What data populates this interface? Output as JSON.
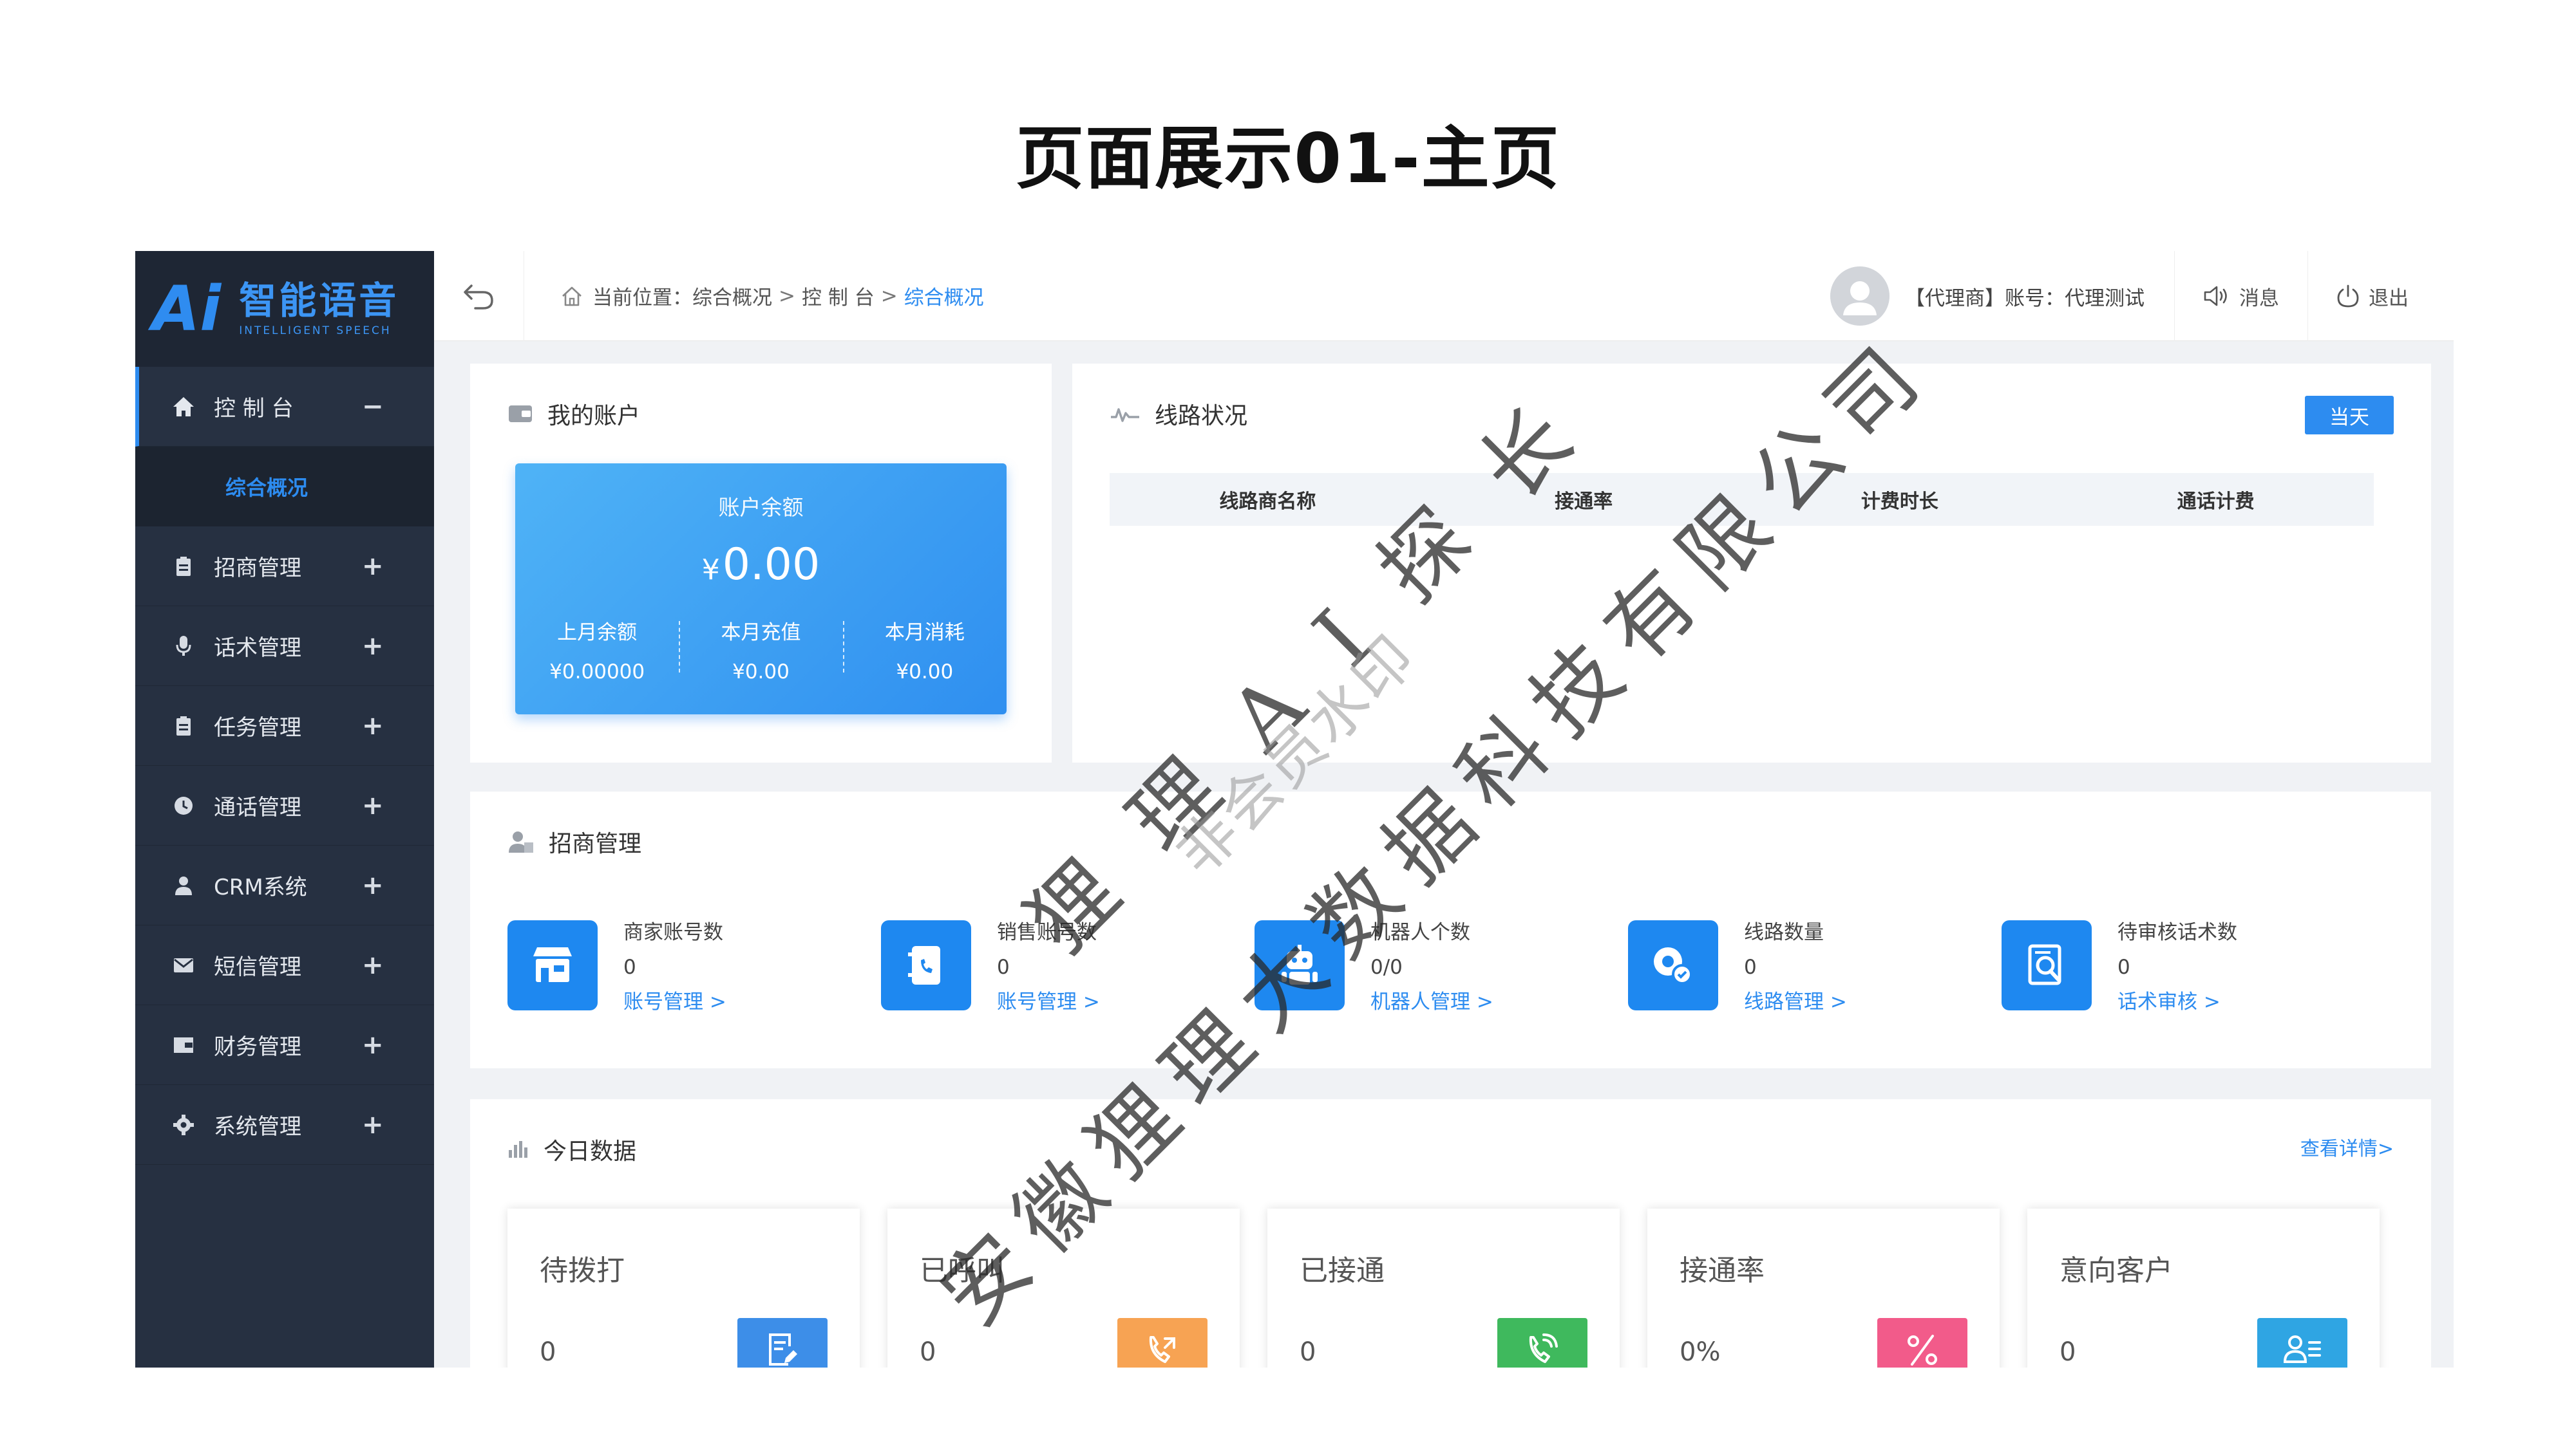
{
  "slide": {
    "title": "页面展示01-主页"
  },
  "logo": {
    "mark": "Ai",
    "name": "智能语音",
    "tagline": "INTELLIGENT SPEECH"
  },
  "sidebar": {
    "items": [
      {
        "label": "控 制 台",
        "toggle": "−",
        "icon": "home-icon",
        "active": true
      },
      {
        "label": "招商管理",
        "toggle": "+",
        "icon": "clipboard-icon"
      },
      {
        "label": "话术管理",
        "toggle": "+",
        "icon": "microphone-icon"
      },
      {
        "label": "任务管理",
        "toggle": "+",
        "icon": "clipboard-icon"
      },
      {
        "label": "通话管理",
        "toggle": "+",
        "icon": "clock-icon"
      },
      {
        "label": "CRM系统",
        "toggle": "+",
        "icon": "user-icon"
      },
      {
        "label": "短信管理",
        "toggle": "+",
        "icon": "envelope-icon"
      },
      {
        "label": "财务管理",
        "toggle": "+",
        "icon": "wallet-icon"
      },
      {
        "label": "系统管理",
        "toggle": "+",
        "icon": "gear-icon"
      }
    ],
    "sub_item": "综合概况"
  },
  "header": {
    "crumb_prefix": "当前位置：综合概况",
    "crumb_sep": ">",
    "crumb_mid": "控 制 台",
    "crumb_current": "综合概况",
    "user_text": "【代理商】账号：代理测试",
    "message": "消息",
    "logout": "退出"
  },
  "account": {
    "title": "我的账户",
    "balance_label": "账户余额",
    "currency": "¥",
    "balance": "0.00",
    "cols": [
      {
        "label": "上月余额",
        "value": "¥0.00000"
      },
      {
        "label": "本月充值",
        "value": "¥0.00"
      },
      {
        "label": "本月消耗",
        "value": "¥0.00"
      }
    ]
  },
  "line_status": {
    "title": "线路状况",
    "button": "当天",
    "columns": [
      "线路商名称",
      "接通率",
      "计费时长",
      "通话计费"
    ]
  },
  "merchant": {
    "title": "招商管理",
    "items": [
      {
        "label": "商家账号数",
        "value": "0",
        "link": "账号管理 >",
        "icon": "store-icon"
      },
      {
        "label": "销售账号数",
        "value": "0",
        "link": "账号管理 >",
        "icon": "phone-book-icon"
      },
      {
        "label": "机器人个数",
        "value": "0/0",
        "link": "机器人管理 >",
        "icon": "robot-icon"
      },
      {
        "label": "线路数量",
        "value": "0",
        "link": "线路管理 >",
        "icon": "line-pin-icon"
      },
      {
        "label": "待审核话术数",
        "value": "0",
        "link": "话术审核 >",
        "icon": "review-icon"
      }
    ]
  },
  "today": {
    "title": "今日数据",
    "more": "查看详情>",
    "stats": [
      {
        "label": "待拨打",
        "value": "0",
        "color": "#3d8ee8",
        "icon": "document-edit-icon"
      },
      {
        "label": "已呼叫",
        "value": "0",
        "color": "#f7a353",
        "icon": "phone-call-icon"
      },
      {
        "label": "已接通",
        "value": "0",
        "color": "#3fb95d",
        "icon": "phone-connected-icon"
      },
      {
        "label": "接通率",
        "value": "0%",
        "color": "#f25b8a",
        "icon": "percent-icon"
      },
      {
        "label": "意向客户",
        "value": "0",
        "color": "#2fa5e3",
        "icon": "user-list-icon"
      }
    ]
  },
  "watermark": {
    "line1": "安徽狸理大数据科技有限公司",
    "line2": "狸理AI探长",
    "line3": "非会员水印"
  },
  "colors": {
    "primary": "#2d8cf0",
    "sidebar": "#263041"
  }
}
